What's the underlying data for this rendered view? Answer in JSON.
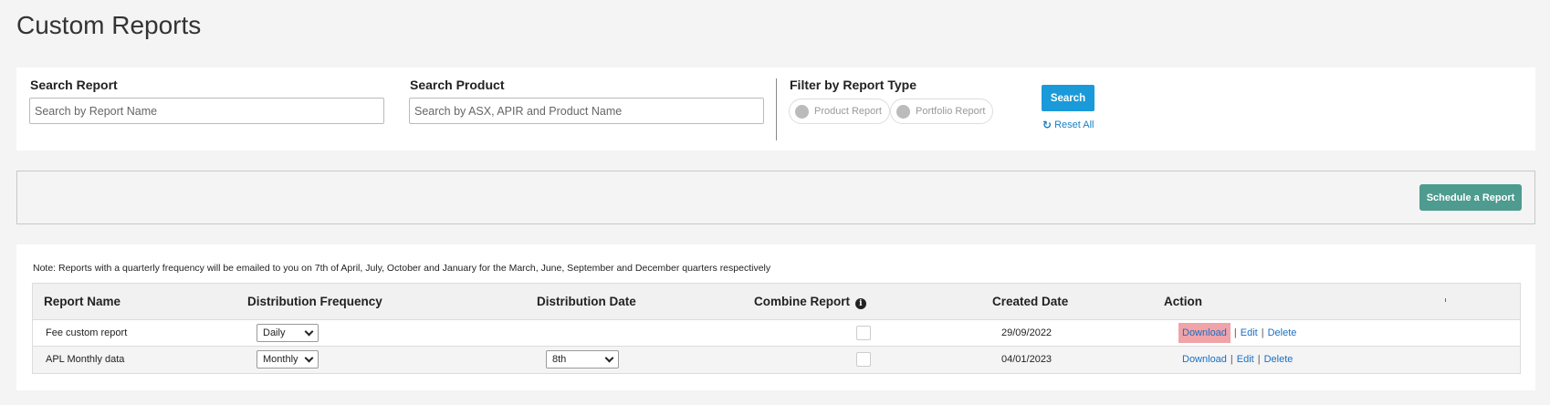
{
  "page": {
    "title": "Custom Reports"
  },
  "filters": {
    "search_report": {
      "label": "Search Report",
      "placeholder": "Search by Report Name",
      "value": ""
    },
    "search_product": {
      "label": "Search Product",
      "placeholder": "Search by ASX, APIR and Product Name",
      "value": ""
    },
    "report_type": {
      "label": "Filter by Report Type",
      "options": [
        "Product Report",
        "Portfolio Report"
      ]
    },
    "search_button": "Search",
    "reset_label": "Reset All",
    "reset_icon": "refresh-icon"
  },
  "schedule": {
    "button": "Schedule a Report"
  },
  "results": {
    "note": "Note: Reports with a quarterly frequency will be emailed to you on 7th of April, July, October and January for the March, June, September and December quarters respectively",
    "columns": [
      "Report Name",
      "Distribution Frequency",
      "Distribution Date",
      "Combine Report",
      "Created Date",
      "Action"
    ],
    "combine_info_icon": "info-icon",
    "rows": [
      {
        "name": "Fee custom report",
        "frequency": "Daily",
        "date": "",
        "combine": false,
        "created": "29/09/2022",
        "actions": [
          "Download",
          "Edit",
          "Delete"
        ]
      },
      {
        "name": "APL Monthly data",
        "frequency": "Monthly",
        "date": "8th",
        "combine": false,
        "created": "04/01/2023",
        "actions": [
          "Download",
          "Edit",
          "Delete"
        ]
      }
    ]
  },
  "colors": {
    "primary": "#1a9ad9",
    "schedule": "#4e9b8f",
    "highlight": "#f0a3a8",
    "link": "#1a6fc4"
  }
}
